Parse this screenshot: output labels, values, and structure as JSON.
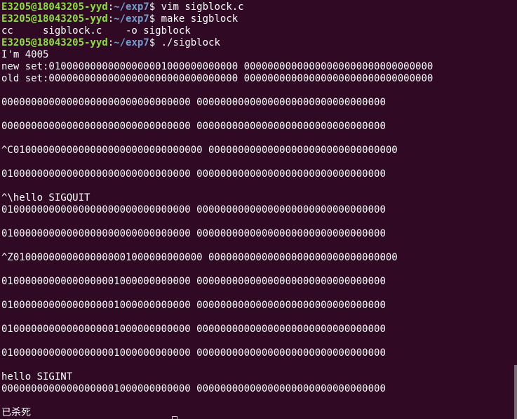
{
  "terminal": {
    "background": "#300a24",
    "prompt_user_color": "#8ae234",
    "prompt_path_color": "#729fcf",
    "lines": [
      {
        "kind": "prompt",
        "user": "E3205@18043205-yyd",
        "path": "~/exp7",
        "cmd": " vim sigblock.c"
      },
      {
        "kind": "prompt",
        "user": "E3205@18043205-yyd",
        "path": "~/exp7",
        "cmd": " make sigblock"
      },
      {
        "kind": "text",
        "text": "cc     sigblock.c    -o sigblock"
      },
      {
        "kind": "prompt",
        "user": "E3205@18043205-yyd",
        "path": "~/exp7",
        "cmd": " ./sigblock"
      },
      {
        "kind": "text",
        "text": "I'm 4005"
      },
      {
        "kind": "text",
        "text": "new set:01000000000000000001000000000000 00000000000000000000000000000000"
      },
      {
        "kind": "text",
        "text": "old set:00000000000000000000000000000000 00000000000000000000000000000000"
      },
      {
        "kind": "text",
        "text": ""
      },
      {
        "kind": "text",
        "text": "00000000000000000000000000000000 00000000000000000000000000000000"
      },
      {
        "kind": "text",
        "text": ""
      },
      {
        "kind": "text",
        "text": "00000000000000000000000000000000 00000000000000000000000000000000"
      },
      {
        "kind": "text",
        "text": ""
      },
      {
        "kind": "text",
        "text": "^C01000000000000000000000000000000 00000000000000000000000000000000"
      },
      {
        "kind": "text",
        "text": ""
      },
      {
        "kind": "text",
        "text": "01000000000000000000000000000000 00000000000000000000000000000000"
      },
      {
        "kind": "text",
        "text": ""
      },
      {
        "kind": "text",
        "text": "^\\hello SIGQUIT"
      },
      {
        "kind": "text",
        "text": "01000000000000000000000000000000 00000000000000000000000000000000"
      },
      {
        "kind": "text",
        "text": ""
      },
      {
        "kind": "text",
        "text": "01000000000000000000000000000000 00000000000000000000000000000000"
      },
      {
        "kind": "text",
        "text": ""
      },
      {
        "kind": "text",
        "text": "^Z01000000000000000001000000000000 00000000000000000000000000000000"
      },
      {
        "kind": "text",
        "text": ""
      },
      {
        "kind": "text",
        "text": "01000000000000000001000000000000 00000000000000000000000000000000"
      },
      {
        "kind": "text",
        "text": ""
      },
      {
        "kind": "text",
        "text": "01000000000000000001000000000000 00000000000000000000000000000000"
      },
      {
        "kind": "text",
        "text": ""
      },
      {
        "kind": "text",
        "text": "01000000000000000001000000000000 00000000000000000000000000000000"
      },
      {
        "kind": "text",
        "text": ""
      },
      {
        "kind": "text",
        "text": "01000000000000000001000000000000 00000000000000000000000000000000"
      },
      {
        "kind": "text",
        "text": ""
      },
      {
        "kind": "text",
        "text": "hello SIGINT"
      },
      {
        "kind": "text",
        "text": "00000000000000000001000000000000 00000000000000000000000000000000"
      },
      {
        "kind": "text",
        "text": ""
      },
      {
        "kind": "text",
        "text": "已杀死",
        "cjk": true
      }
    ]
  }
}
